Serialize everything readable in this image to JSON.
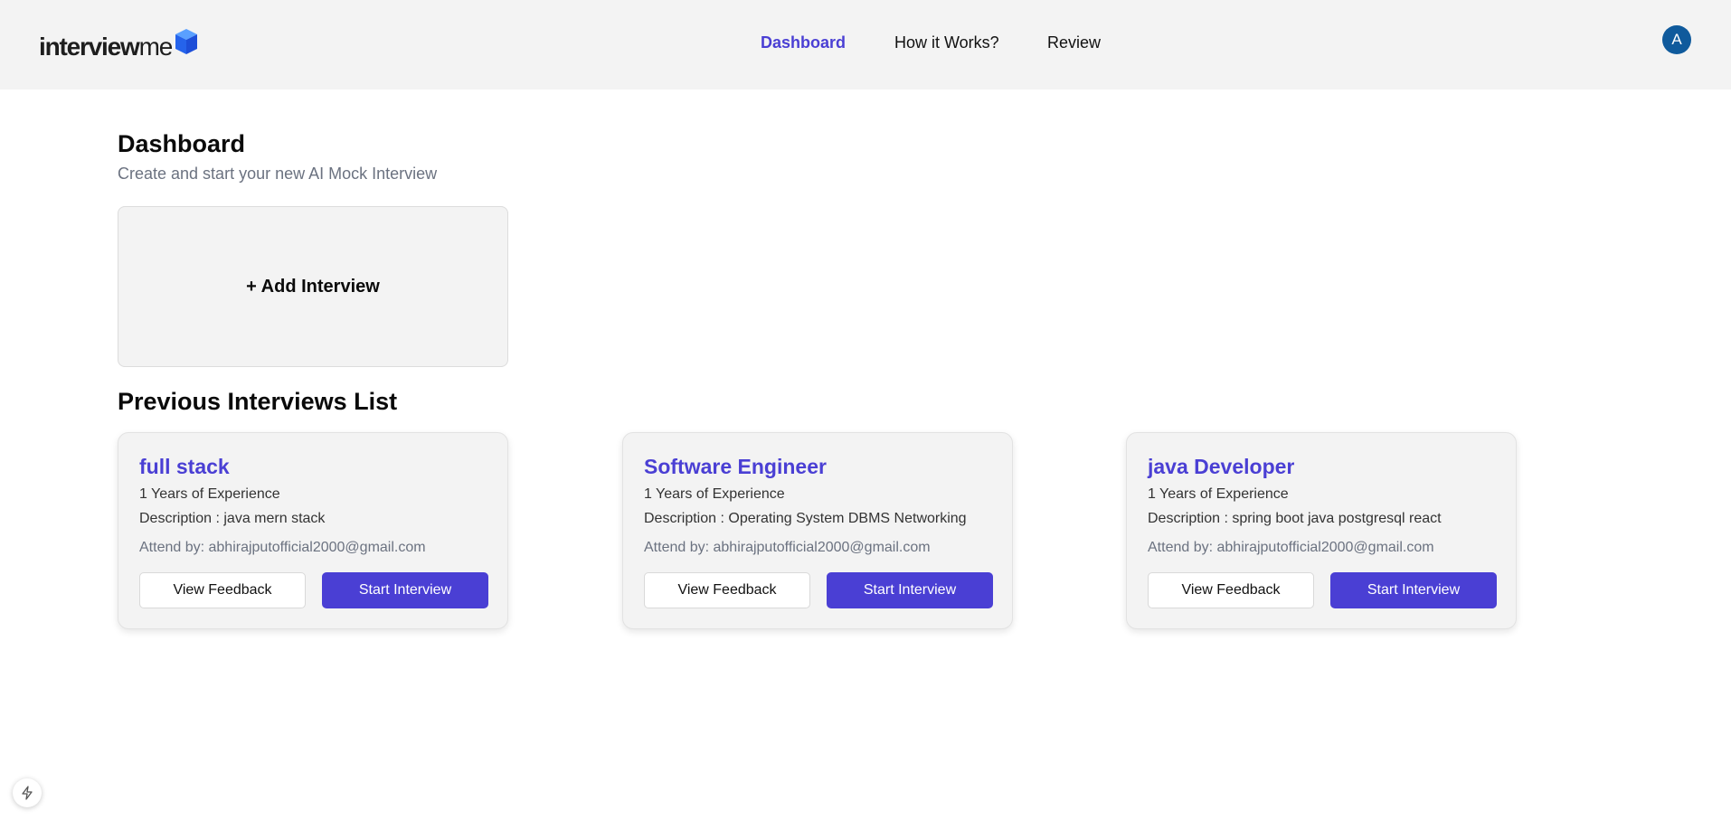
{
  "header": {
    "logo": {
      "bold": "interview",
      "light": "me"
    },
    "nav": [
      {
        "label": "Dashboard",
        "active": true
      },
      {
        "label": "How it Works?",
        "active": false
      },
      {
        "label": "Review",
        "active": false
      }
    ],
    "avatar_initial": "A"
  },
  "dashboard": {
    "title": "Dashboard",
    "subtitle": "Create and start your new AI Mock Interview",
    "add_label": "+ Add Interview"
  },
  "previous": {
    "title": "Previous Interviews List",
    "cards": [
      {
        "role": "full stack",
        "experience": "1 Years of Experience",
        "description": "Description : java mern stack",
        "attend": "Attend by: abhirajputofficial2000@gmail.com",
        "feedback_label": "View Feedback",
        "start_label": "Start Interview"
      },
      {
        "role": "Software Engineer",
        "experience": "1 Years of Experience",
        "description": "Description : Operating System DBMS Networking",
        "attend": "Attend by: abhirajputofficial2000@gmail.com",
        "feedback_label": "View Feedback",
        "start_label": "Start Interview"
      },
      {
        "role": "java Developer",
        "experience": "1 Years of Experience",
        "description": "Description : spring boot java postgresql react",
        "attend": "Attend by: abhirajputofficial2000@gmail.com",
        "feedback_label": "View Feedback",
        "start_label": "Start Interview"
      }
    ]
  },
  "colors": {
    "accent": "#4a3fd4",
    "header_bg": "#f3f3f3",
    "avatar_bg": "#0f5a9c",
    "logo_cube": "#3b82f6"
  },
  "icons": {
    "logo": "cube-icon",
    "devtools": "lightning-icon"
  }
}
